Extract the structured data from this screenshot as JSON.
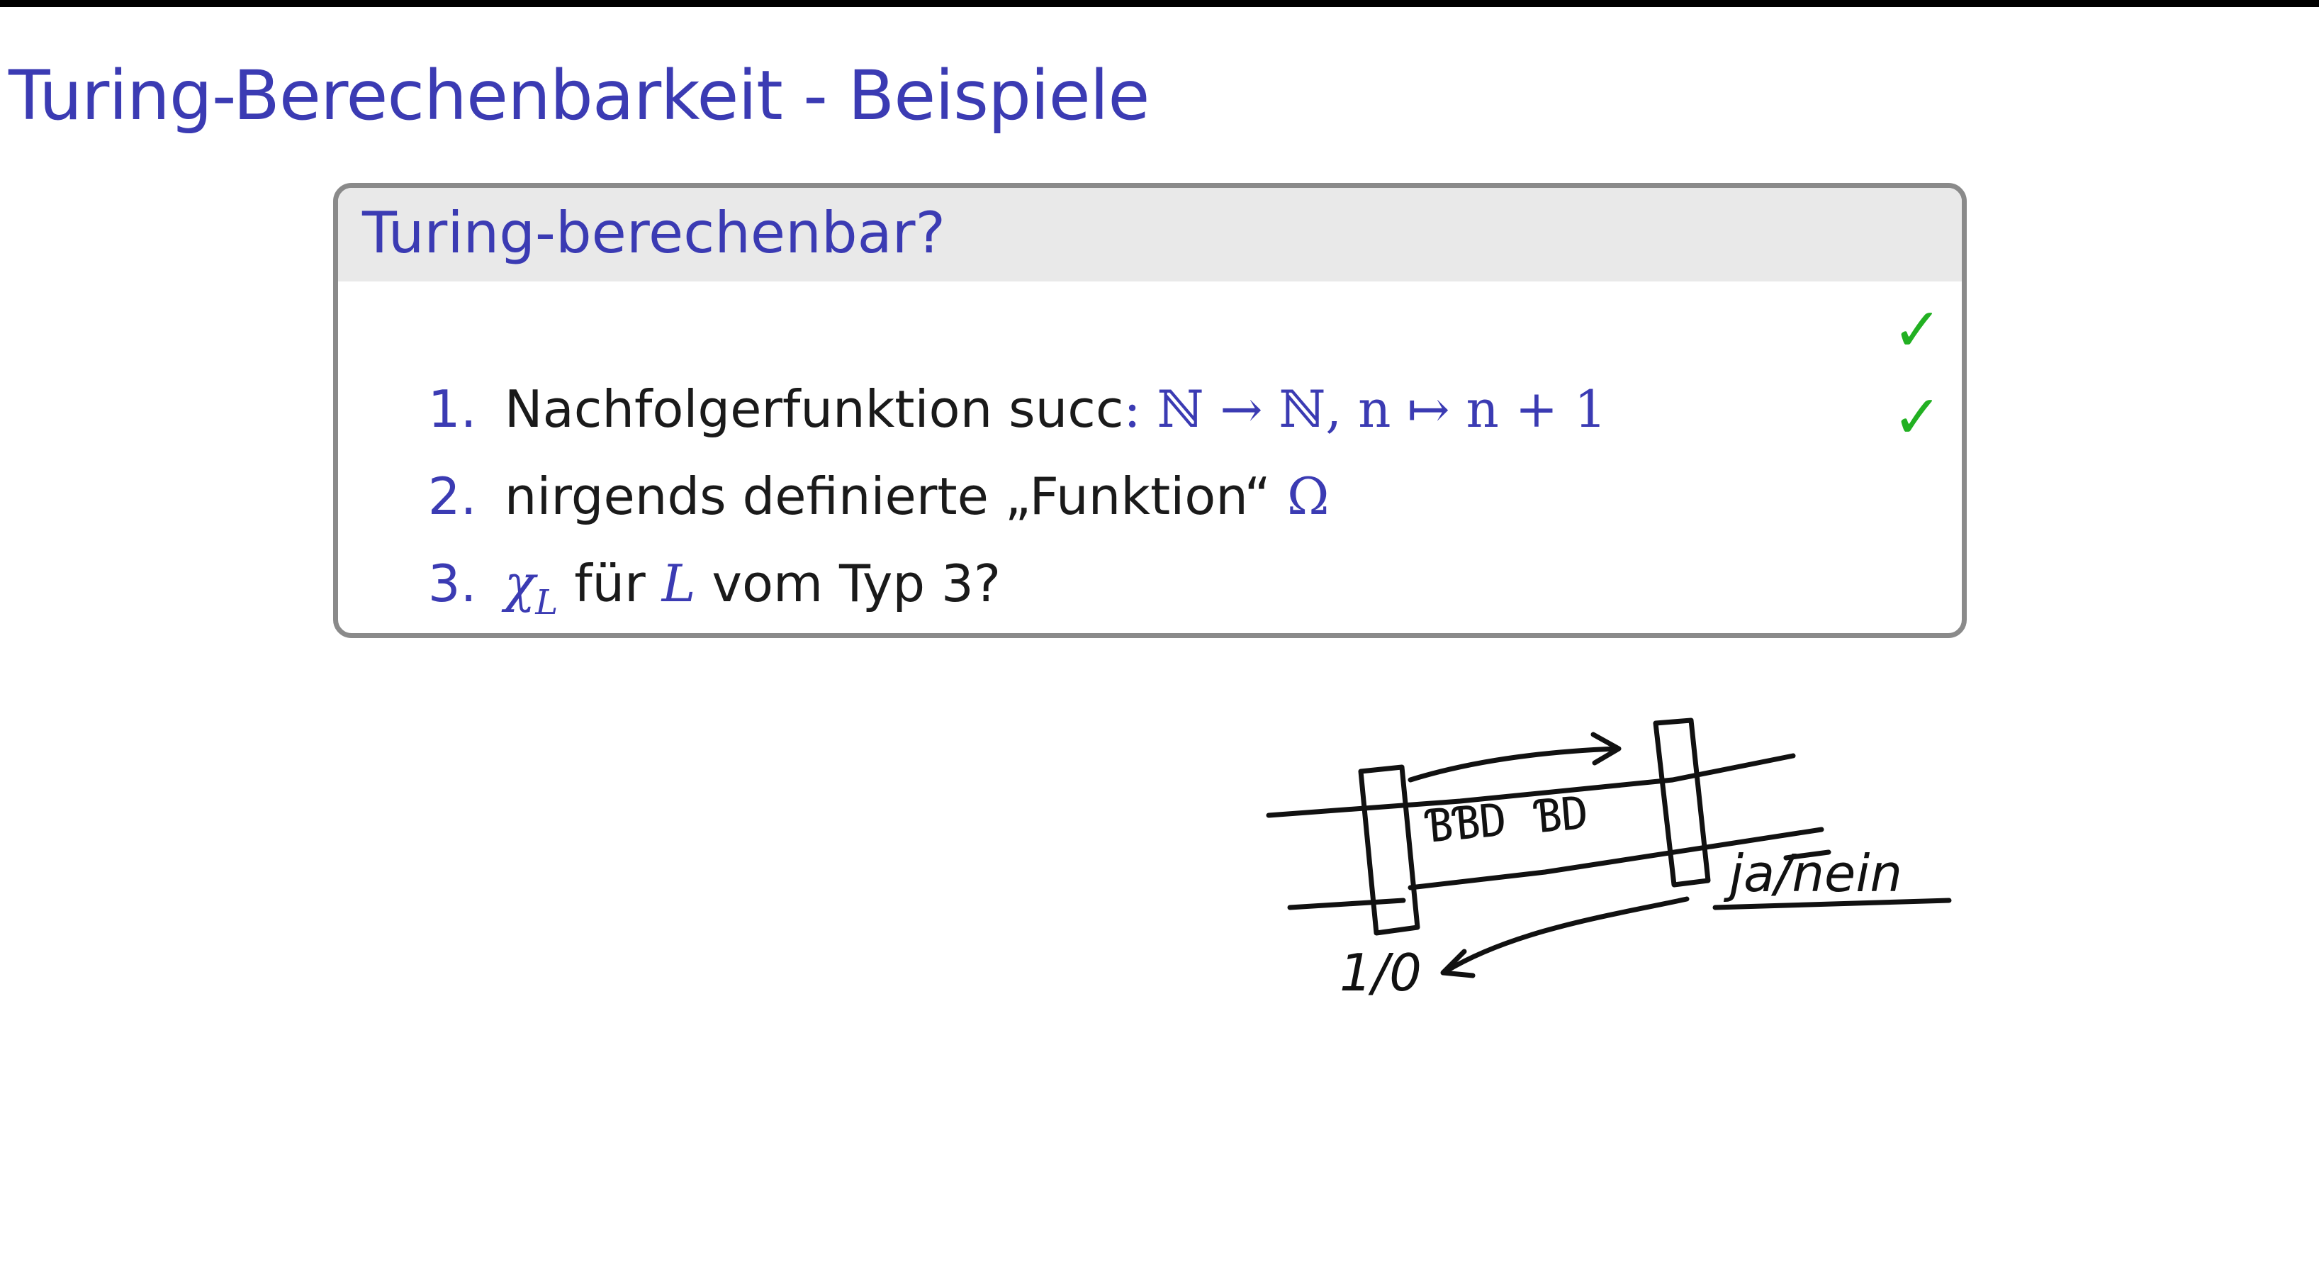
{
  "slide": {
    "title": "Turing-Berechenbarkeit - Beispiele"
  },
  "block": {
    "title": "Turing-berechenbar?",
    "items": [
      {
        "num": "1.",
        "text": "Nachfolgerfunktion succ",
        "math": ": ℕ → ℕ, n ↦ n + 1",
        "checked": true
      },
      {
        "num": "2.",
        "text": "nirgends definierte „Funktion“",
        "math": "Ω",
        "checked": true
      },
      {
        "num": "3.",
        "math_pre": "χ",
        "math_sub": "L",
        "text_mid": "für",
        "math_mid": "L",
        "text_post": "vom Typ 3?",
        "checked": false
      }
    ],
    "check_symbol": "✓"
  },
  "sketch": {
    "tape_cells": "ƁƁD ƁD",
    "output_label": "ja/nein",
    "input_label": "1/0"
  },
  "colors": {
    "title": "#3b3bb3",
    "check": "#22b022",
    "block_border": "#8a8a8a",
    "block_header": "#e9e9e9",
    "ink": "#111111"
  }
}
